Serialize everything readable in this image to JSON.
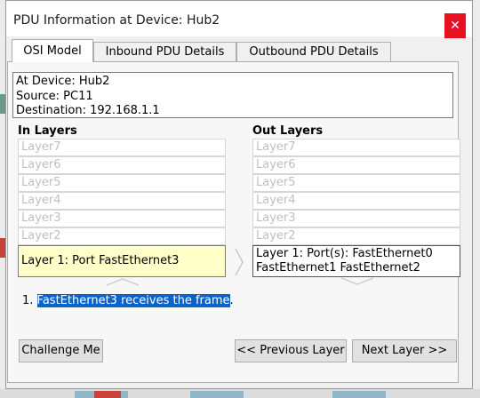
{
  "window": {
    "title": "PDU Information at Device: Hub2",
    "close_glyph": "✕"
  },
  "tabs": [
    {
      "label": "OSI Model"
    },
    {
      "label": "Inbound PDU Details"
    },
    {
      "label": "Outbound PDU Details"
    }
  ],
  "info": {
    "device": "At Device: Hub2",
    "source": "Source: PC11",
    "destination": "Destination: 192.168.1.1"
  },
  "in_layers": {
    "heading": "In Layers",
    "items": [
      "Layer7",
      "Layer6",
      "Layer5",
      "Layer4",
      "Layer3",
      "Layer2"
    ],
    "active": "Layer 1: Port FastEthernet3"
  },
  "out_layers": {
    "heading": "Out Layers",
    "items": [
      "Layer7",
      "Layer6",
      "Layer5",
      "Layer4",
      "Layer3",
      "Layer2"
    ],
    "active_line1": "Layer 1: Port(s): FastEthernet0",
    "active_line2": "FastEthernet1 FastEthernet2"
  },
  "steps": {
    "number": "1.",
    "text": "FastEthernet3 receives the frame",
    "suffix": "."
  },
  "buttons": {
    "challenge": "Challenge Me",
    "previous": "<< Previous Layer",
    "next": "Next Layer >>"
  },
  "colors": {
    "active_in_layer": "#ffffc8",
    "selection_highlight": "#0a64c8",
    "close_button": "#e81123"
  }
}
